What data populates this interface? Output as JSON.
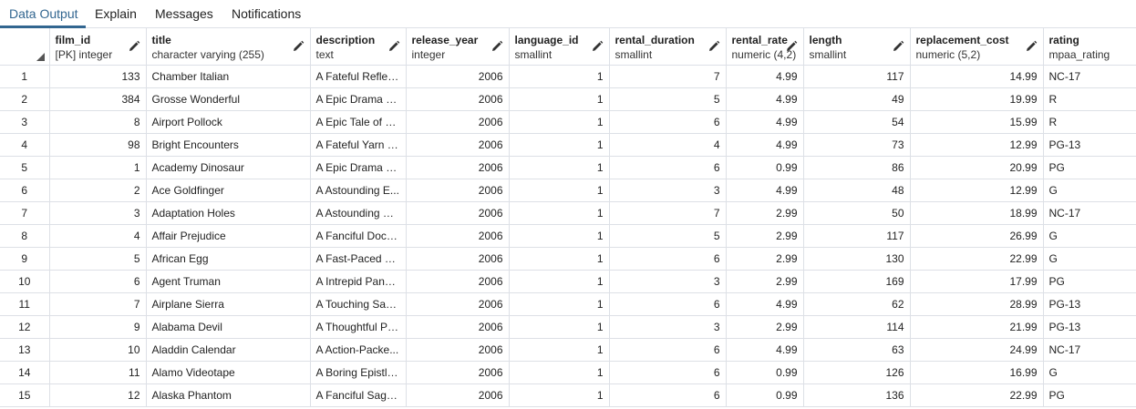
{
  "tabs": [
    {
      "label": "Data Output",
      "active": true
    },
    {
      "label": "Explain",
      "active": false
    },
    {
      "label": "Messages",
      "active": false
    },
    {
      "label": "Notifications",
      "active": false
    }
  ],
  "columns": [
    {
      "name": "film_id",
      "type": "[PK] integer",
      "align": "right"
    },
    {
      "name": "title",
      "type": "character varying (255)",
      "align": "left"
    },
    {
      "name": "description",
      "type": "text",
      "align": "left"
    },
    {
      "name": "release_year",
      "type": "integer",
      "align": "right"
    },
    {
      "name": "language_id",
      "type": "smallint",
      "align": "right"
    },
    {
      "name": "rental_duration",
      "type": "smallint",
      "align": "right"
    },
    {
      "name": "rental_rate",
      "type": "numeric (4,2)",
      "align": "right"
    },
    {
      "name": "length",
      "type": "smallint",
      "align": "right"
    },
    {
      "name": "replacement_cost",
      "type": "numeric (5,2)",
      "align": "right"
    },
    {
      "name": "rating",
      "type": "mpaa_rating",
      "align": "left"
    }
  ],
  "rows": [
    [
      "1",
      "133",
      "Chamber Italian",
      "A Fateful Reflec...",
      "2006",
      "1",
      "7",
      "4.99",
      "117",
      "14.99",
      "NC-17"
    ],
    [
      "2",
      "384",
      "Grosse Wonderful",
      "A Epic Drama of...",
      "2006",
      "1",
      "5",
      "4.99",
      "49",
      "19.99",
      "R"
    ],
    [
      "3",
      "8",
      "Airport Pollock",
      "A Epic Tale of a ...",
      "2006",
      "1",
      "6",
      "4.99",
      "54",
      "15.99",
      "R"
    ],
    [
      "4",
      "98",
      "Bright Encounters",
      "A Fateful Yarn o...",
      "2006",
      "1",
      "4",
      "4.99",
      "73",
      "12.99",
      "PG-13"
    ],
    [
      "5",
      "1",
      "Academy Dinosaur",
      "A Epic Drama of...",
      "2006",
      "1",
      "6",
      "0.99",
      "86",
      "20.99",
      "PG"
    ],
    [
      "6",
      "2",
      "Ace Goldfinger",
      "A Astounding E...",
      "2006",
      "1",
      "3",
      "4.99",
      "48",
      "12.99",
      "G"
    ],
    [
      "7",
      "3",
      "Adaptation Holes",
      "A Astounding R...",
      "2006",
      "1",
      "7",
      "2.99",
      "50",
      "18.99",
      "NC-17"
    ],
    [
      "8",
      "4",
      "Affair Prejudice",
      "A Fanciful Docu...",
      "2006",
      "1",
      "5",
      "2.99",
      "117",
      "26.99",
      "G"
    ],
    [
      "9",
      "5",
      "African Egg",
      "A Fast-Paced D...",
      "2006",
      "1",
      "6",
      "2.99",
      "130",
      "22.99",
      "G"
    ],
    [
      "10",
      "6",
      "Agent Truman",
      "A Intrepid Panor...",
      "2006",
      "1",
      "3",
      "2.99",
      "169",
      "17.99",
      "PG"
    ],
    [
      "11",
      "7",
      "Airplane Sierra",
      "A Touching Sag...",
      "2006",
      "1",
      "6",
      "4.99",
      "62",
      "28.99",
      "PG-13"
    ],
    [
      "12",
      "9",
      "Alabama Devil",
      "A Thoughtful Pa...",
      "2006",
      "1",
      "3",
      "2.99",
      "114",
      "21.99",
      "PG-13"
    ],
    [
      "13",
      "10",
      "Aladdin Calendar",
      "A Action-Packe...",
      "2006",
      "1",
      "6",
      "4.99",
      "63",
      "24.99",
      "NC-17"
    ],
    [
      "14",
      "11",
      "Alamo Videotape",
      "A Boring Epistle...",
      "2006",
      "1",
      "6",
      "0.99",
      "126",
      "16.99",
      "G"
    ],
    [
      "15",
      "12",
      "Alaska Phantom",
      "A Fanciful Saga ...",
      "2006",
      "1",
      "6",
      "0.99",
      "136",
      "22.99",
      "PG"
    ]
  ],
  "icons": {
    "edit": "pencil-icon",
    "select_all": "corner-select-icon"
  },
  "colors": {
    "accent": "#326690",
    "grid_line": "#dde0e6"
  }
}
